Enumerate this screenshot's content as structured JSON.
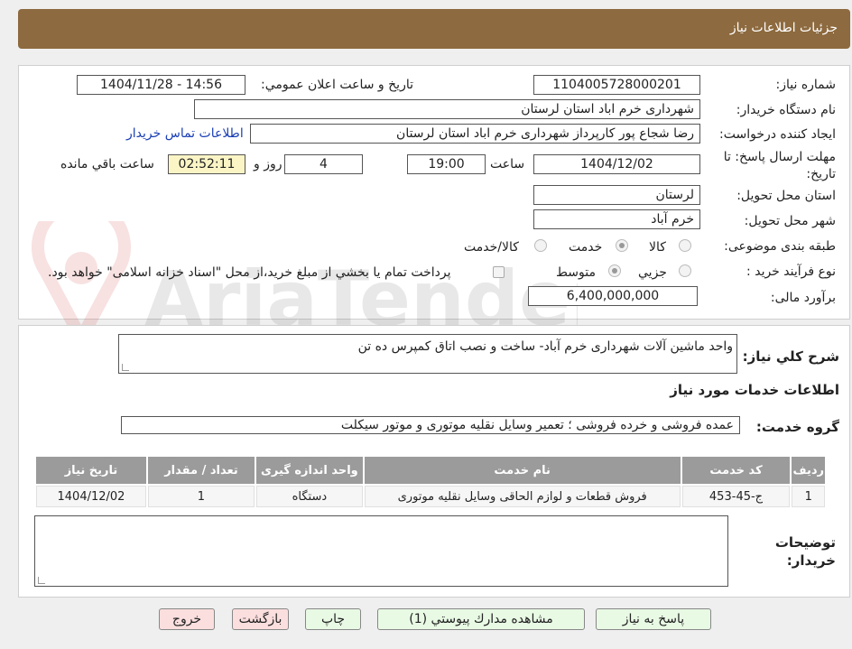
{
  "header": {
    "title": "جزئيات اطلاعات نياز"
  },
  "form": {
    "need_number_label": "شماره نياز:",
    "need_number": "1104005728000201",
    "announce_label": "تاريخ و ساعت اعلان عمومي:",
    "announce_value": "1404/11/28 - 14:56",
    "buyer_org_label": "نام دستگاه خريدار:",
    "buyer_org": "شهرداری خرم اباد استان لرستان",
    "creator_label": "ايجاد كننده درخواست:",
    "creator": "رضا شجاع پور کارپرداز شهرداری خرم اباد استان لرستان",
    "contact_link": "اطلاعات تماس خريدار",
    "deadline_label": "مهلت ارسال پاسخ: تا تاريخ:",
    "deadline_date": "1404/12/02",
    "time_label": "ساعت",
    "deadline_time": "19:00",
    "days": "4",
    "days_label": "روز و",
    "remaining_time": "02:52:11",
    "remaining_label": "ساعت باقي مانده",
    "province_label": "استان محل تحويل:",
    "province": "لرستان",
    "city_label": "شهر محل تحويل:",
    "city": "خرم آباد",
    "category_label": "طبقه بندی موضوعی:",
    "category_options": [
      "كالا",
      "خدمت",
      "كالا/خدمت"
    ],
    "category_selected": "خدمت",
    "process_label": "نوع فرآيند خريد :",
    "process_options": [
      "جزيي",
      "متوسط"
    ],
    "process_selected": "متوسط",
    "payment_note": "پرداخت تمام يا بخشي از مبلغ خريد،از محل \"اسناد خزانه اسلامی\" خواهد بود.",
    "budget_label": "برآورد مالی:",
    "budget": "6,400,000,000"
  },
  "description": {
    "label": "شرح كلي نياز:",
    "text": "واحد ماشین آلات شهرداری خرم آباد- ساخت و نصب اتاق کمپرس ده تن"
  },
  "services": {
    "section_title": "اطلاعات خدمات مورد نياز",
    "group_label": "گروه خدمت:",
    "group_value": "عمده فروشی و خرده فروشی ؛ تعمیر وسایل نقلیه موتوری و موتور سیکلت",
    "columns": [
      "رديف",
      "كد خدمت",
      "نام خدمت",
      "واحد اندازه گيری",
      "تعداد / مقدار",
      "تاريخ نياز"
    ],
    "rows": [
      [
        "1",
        "ج-45-453",
        "فروش قطعات و لوازم الحاقی وسایل نقلیه موتوری",
        "دستگاه",
        "1",
        "1404/12/02"
      ]
    ]
  },
  "buyer_notes": {
    "label_line1": "توضيحات",
    "label_line2": "خريدار:",
    "text": ""
  },
  "buttons": {
    "reply": "پاسخ به نياز",
    "attachments": "مشاهده مدارك پيوستي (1)",
    "print": "چاپ",
    "back": "بازگشت",
    "exit": "خروج"
  },
  "watermark": {
    "text": "AriaTender.neT"
  },
  "colors": {
    "header": "#8d6a3f",
    "table_header": "#9b9b9b",
    "button_green": "#e8f9e4",
    "button_red": "#fbdede",
    "timer_bg": "#fbf5c6"
  }
}
